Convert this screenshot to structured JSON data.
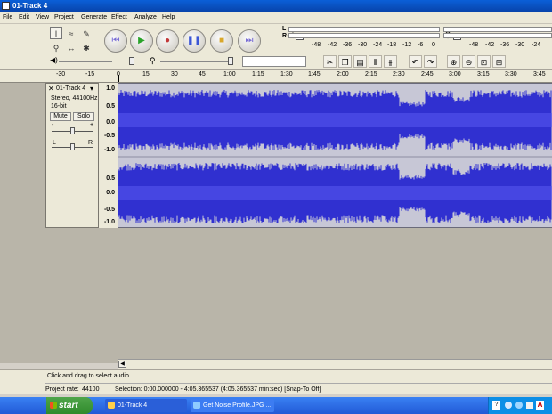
{
  "window": {
    "title": "01-Track 4"
  },
  "menu": [
    "File",
    "Edit",
    "View",
    "Project",
    "Generate",
    "Effect",
    "Analyze",
    "Help"
  ],
  "meters": {
    "output_channel_top": "L",
    "output_channel_bottom": "R",
    "output_scale": [
      "-48",
      "-42",
      "-36",
      "-30",
      "-24",
      "-18",
      "-12",
      "-6",
      "0"
    ],
    "input_scale": [
      "-48",
      "-42",
      "-36",
      "-30",
      "-24",
      "-18",
      "-12",
      "-6",
      "0"
    ]
  },
  "ruler": {
    "labels": [
      "-30",
      "-15",
      "0",
      "15",
      "30",
      "45",
      "1:00",
      "1:15",
      "1:30",
      "1:45",
      "2:00",
      "2:15",
      "2:30",
      "2:45",
      "3:00",
      "3:15",
      "3:30",
      "3:45"
    ]
  },
  "track": {
    "name": "01-Track 4",
    "format": "Stereo, 44100Hz",
    "bit_depth": "16-bit",
    "mute_label": "Mute",
    "solo_label": "Solo",
    "gain_minus": "-",
    "gain_plus": "+",
    "pan_left": "L",
    "pan_right": "R",
    "y_labels_top": [
      "1.0",
      "0.5",
      "0.0",
      "-0.5",
      "-1.0"
    ],
    "y_labels_bottom": [
      "0.5",
      "0.0",
      "-0.5",
      "-1.0"
    ],
    "wave_color": "#3030d0"
  },
  "status": {
    "message": "Click and drag to select audio",
    "project_rate_label": "Project rate:",
    "project_rate": "44100",
    "selection": "Selection: 0:00.000000 - 4:05.365537 (4:05.365537 min:sec)   [Snap-To Off]"
  },
  "taskbar": {
    "start_label": "start",
    "tasks": [
      "01-Track 4",
      "Get Noise Profile.JPG ..."
    ]
  }
}
